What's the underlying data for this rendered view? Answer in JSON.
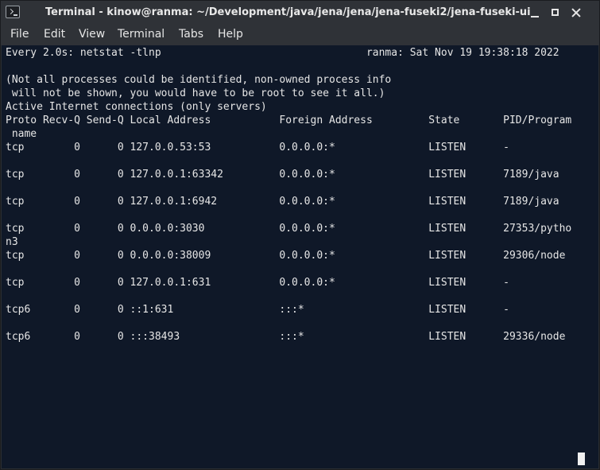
{
  "window": {
    "title": "Terminal - kinow@ranma: ~/Development/java/jena/jena/jena-fuseki2/jena-fuseki-ui"
  },
  "menu": {
    "file": "File",
    "edit": "Edit",
    "view": "View",
    "terminal": "Terminal",
    "tabs": "Tabs",
    "help": "Help"
  },
  "icons": {
    "app": "terminal-app-icon",
    "minimize": "minimize-icon",
    "maximize": "maximize-icon",
    "close": "close-icon"
  },
  "colors": {
    "terminal_bg": "#0f1828",
    "chrome_bg": "#2f3237",
    "text": "#e6e6e6"
  },
  "terminal": {
    "lines": [
      "Every 2.0s: netstat -tlnp                                 ranma: Sat Nov 19 19:38:18 2022",
      "",
      "(Not all processes could be identified, non-owned process info",
      " will not be shown, you would have to be root to see it all.)",
      "Active Internet connections (only servers)",
      "Proto Recv-Q Send-Q Local Address           Foreign Address         State       PID/Program",
      " name",
      "tcp        0      0 127.0.0.53:53           0.0.0.0:*               LISTEN      -",
      "",
      "tcp        0      0 127.0.0.1:63342         0.0.0.0:*               LISTEN      7189/java",
      "",
      "tcp        0      0 127.0.0.1:6942          0.0.0.0:*               LISTEN      7189/java",
      "",
      "tcp        0      0 0.0.0.0:3030            0.0.0.0:*               LISTEN      27353/pytho",
      "n3",
      "tcp        0      0 0.0.0.0:38009           0.0.0.0:*               LISTEN      29306/node",
      "",
      "tcp        0      0 127.0.0.1:631           0.0.0.0:*               LISTEN      -",
      "",
      "tcp6       0      0 ::1:631                 :::*                    LISTEN      -",
      "",
      "tcp6       0      0 :::38493                :::*                    LISTEN      29336/node"
    ]
  }
}
